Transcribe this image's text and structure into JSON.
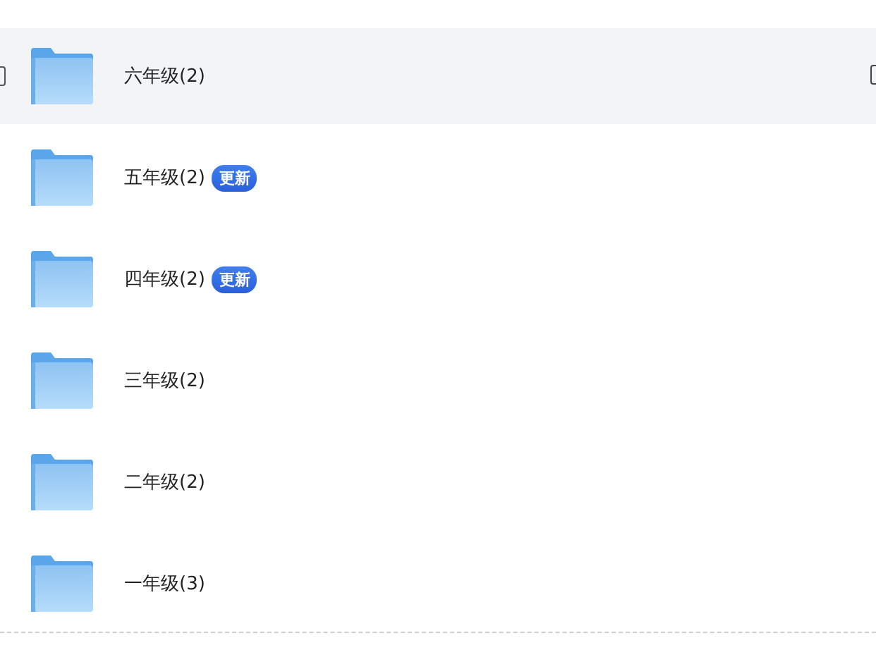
{
  "folders": [
    {
      "name": "六年级(2)",
      "updated": false,
      "hovered": true,
      "checked": false
    },
    {
      "name": "五年级(2)",
      "updated": true,
      "badge": "更新",
      "hovered": false
    },
    {
      "name": "四年级(2)",
      "updated": true,
      "badge": "更新",
      "hovered": false
    },
    {
      "name": "三年级(2)",
      "updated": false,
      "hovered": false
    },
    {
      "name": "二年级(2)",
      "updated": false,
      "hovered": false
    },
    {
      "name": "一年级(3)",
      "updated": false,
      "hovered": false
    }
  ]
}
